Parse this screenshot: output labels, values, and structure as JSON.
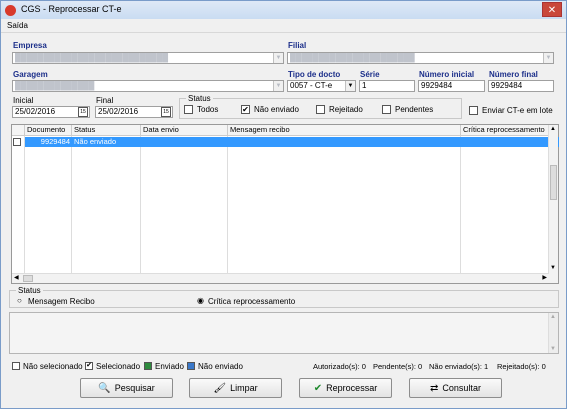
{
  "window": {
    "title": "CGS - Reprocessar CT-e",
    "close_glyph": "✕"
  },
  "menu": {
    "saida": "Saída"
  },
  "form": {
    "empresa_label": "Empresa",
    "filial_label": "Filial",
    "garagem_label": "Garagem",
    "tipo_docto_label": "Tipo de docto",
    "tipo_docto_value": "0057 - CT-e",
    "serie_label": "Série",
    "serie_value": "1",
    "numero_inicial_label": "Número inicial",
    "numero_inicial_value": "9929484",
    "numero_final_label": "Número final",
    "numero_final_value": "9929484",
    "inicial_label": "Inicial",
    "inicial_value": "25/02/2016",
    "final_label": "Final",
    "final_value": "25/02/2016",
    "calendar_glyph": "15"
  },
  "status_filter": {
    "legend": "Status",
    "todos": "Todos",
    "nao_enviado": "Não enviado",
    "rejeitado": "Rejeitado",
    "pendentes": "Pendentes"
  },
  "enviar_cte_lote": "Enviar CT-e em lote",
  "grid": {
    "columns": [
      "Documento",
      "Status",
      "Data envio",
      "Mensagem recibo",
      "Crítica reprocessamento"
    ],
    "rows": [
      {
        "documento": "9929484",
        "status": "Não enviado",
        "data_envio": "",
        "mensagem": "",
        "critica": ""
      }
    ]
  },
  "status_view": {
    "legend": "Status",
    "mensagem_recibo": "Mensagem Recibo",
    "critica_reprocessamento": "Crítica reprocessamento"
  },
  "legend_bar": {
    "nao_selecionado": "Não selecionado",
    "selecionado": "Selecionado",
    "enviado": "Enviado",
    "nao_enviado": "Não enviado",
    "enviado_color": "#2e8b3e",
    "nao_enviado_color": "#3a78c9"
  },
  "counters": {
    "autorizados": "Autorizado(s): 0",
    "pendentes": "Pendente(s): 0",
    "nao_enviados": "Não enviado(s): 1",
    "rejeitados": "Rejeitado(s): 0"
  },
  "buttons": {
    "pesquisar": "Pesquisar",
    "limpar": "Limpar",
    "reprocessar": "Reprocessar",
    "consultar": "Consultar"
  },
  "icons": {
    "pesquisar": "🔍",
    "limpar": "🖌",
    "reprocessar": "✔",
    "consultar": "⇄"
  }
}
